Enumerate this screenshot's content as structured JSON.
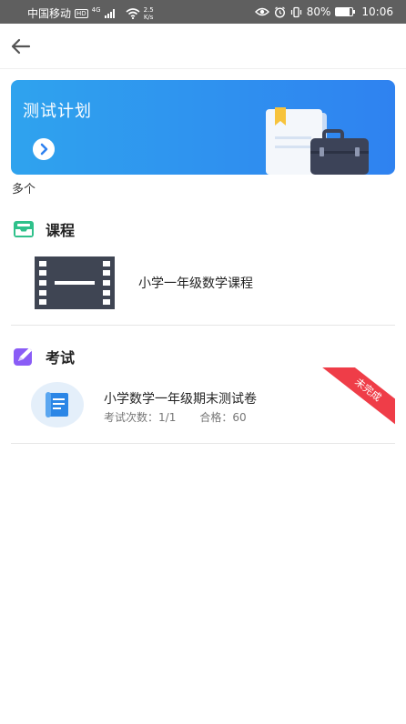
{
  "status_bar": {
    "carrier": "中国移动",
    "network_badge": "HD",
    "network_type": "4G",
    "speed_value": "2.5",
    "speed_unit": "K/s",
    "battery_percent": "80%",
    "time": "10:06",
    "battery_level": 0.8
  },
  "header": {
    "back_icon": "arrow-left-icon"
  },
  "banner": {
    "title": "测试计划",
    "go_icon": "chevron-right-circle-icon",
    "subtitle": "多个"
  },
  "course_section": {
    "title": "课程",
    "icon": "tray-icon",
    "icon_color": "#2fc18b",
    "items": [
      {
        "title": "小学一年级数学课程",
        "thumb_icon": "video-film-icon"
      }
    ]
  },
  "exam_section": {
    "title": "考试",
    "icon": "edit-pen-icon",
    "icon_color": "#8a5cf6",
    "items": [
      {
        "title": "小学数学一年级期末测试卷",
        "attempts_label": "考试次数：",
        "attempts_value": "1/1",
        "pass_label": "合格：",
        "pass_value": "60",
        "status": "未完成",
        "status_color": "#ef3d48",
        "icon": "scroll-document-icon"
      }
    ]
  }
}
